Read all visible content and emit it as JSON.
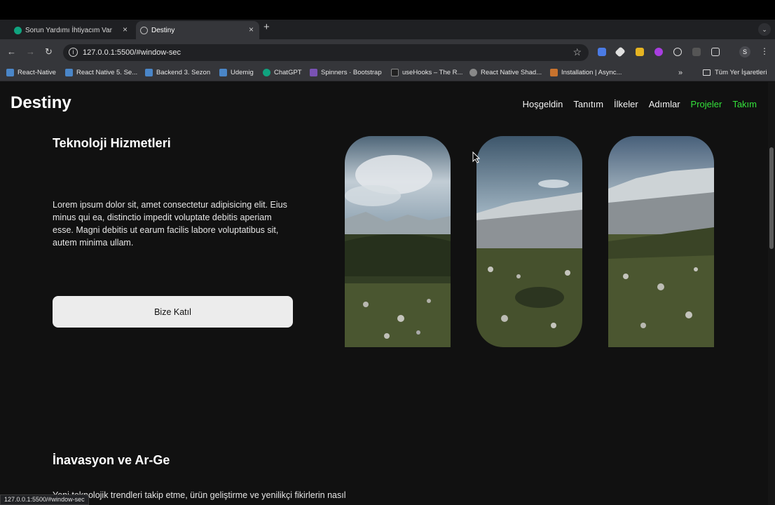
{
  "browser": {
    "tabs": [
      {
        "title": "Sorun Yardımı İhtiyacım Var",
        "close": "×"
      },
      {
        "title": "Destiny",
        "close": "×"
      }
    ],
    "new_tab": "+",
    "url": "127.0.0.1:5500/#window-sec",
    "profile_initial": "S",
    "bookmarks": [
      "React-Native",
      "React Native 5. Se...",
      "Backend 3. Sezon",
      "Udemig",
      "ChatGPT",
      "Spinners · Bootstrap",
      "useHooks – The R...",
      "React Native Shad...",
      "Installation | Async..."
    ],
    "bookmarks_folder": "Tüm Yer İşaretleri",
    "status_url": "127.0.0.1:5500/#window-sec"
  },
  "site": {
    "brand": "Destiny",
    "nav": [
      "Hoşgeldin",
      "Tanıtım",
      "İlkeler",
      "Adımlar",
      "Projeler",
      "Takım"
    ],
    "active_color": "#34e23b",
    "section1": {
      "title": "Teknoloji Hizmetleri",
      "text": "Lorem ipsum dolor sit, amet consectetur adipisicing elit. Eius minus qui ea, distinctio impedit voluptate debitis aperiam esse. Magni debitis ut earum facilis labore voluptatibus sit, autem minima ullam.",
      "button": "Bize Katıl"
    },
    "section2": {
      "title": "İnavasyon ve Ar-Ge",
      "text": "Yeni teknolojik trendleri takip etme, ürün geliştirme ve yenilikçi fikirlerin nasıl"
    }
  }
}
